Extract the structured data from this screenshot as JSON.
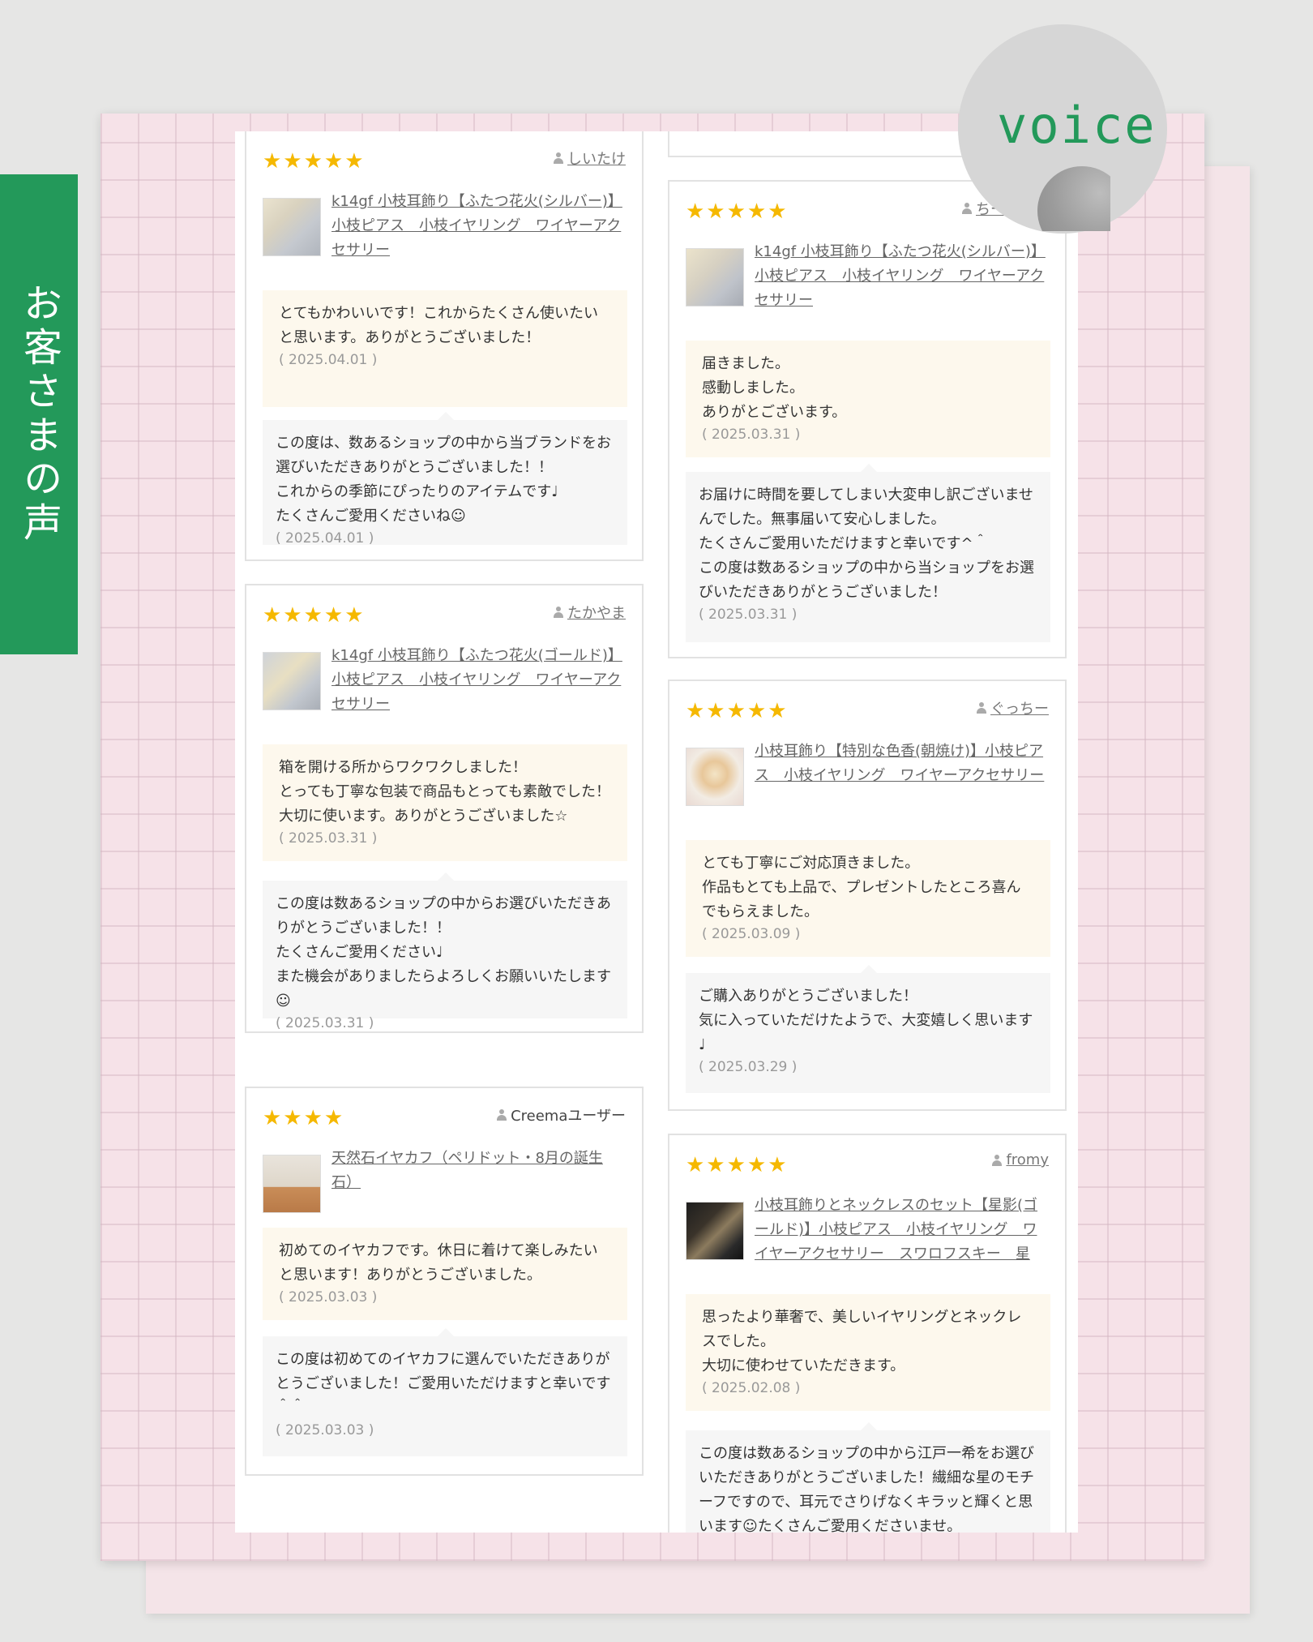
{
  "side_label": "お客さまの声",
  "badge": "voice",
  "reviews": [
    {
      "stars": "★★★★★",
      "user": "しいたけ",
      "product": "k14gf 小枝耳飾り【ふたつ花火(シルバー)】小枝ピアス　小枝イヤリング　ワイヤーアクセサリー",
      "buyer_msg": "とてもかわいいです！これからたくさん使いたいと思います。ありがとうございました！",
      "buyer_date": "( 2025.04.01 )",
      "shop_msg": "この度は、数あるショップの中から当ブランドをお選びいただきありがとうございました！！\nこれからの季節にぴったりのアイテムです♩\nたくさんご愛用くださいね☺",
      "shop_date": "( 2025.04.01 )"
    },
    {
      "stars": "★★★★★",
      "user": "たかやま",
      "product": "k14gf 小枝耳飾り【ふたつ花火(ゴールド)】小枝ピアス　小枝イヤリング　ワイヤーアクセサリー",
      "buyer_msg": "箱を開ける所からワクワクしました！\nとっても丁寧な包装で商品もとっても素敵でした！大切に使います。ありがとうございました☆",
      "buyer_date": "( 2025.03.31 )",
      "shop_msg": "この度は数あるショップの中からお選びいただきありがとうございました！！\nたくさんご愛用ください♩\nまた機会がありましたらよろしくお願いいたします☺",
      "shop_date": "( 2025.03.31 )"
    },
    {
      "stars": "★★★★",
      "user": "Creemaユーザー",
      "product": "天然石イヤカフ（ペリドット・8月の誕生石）",
      "buyer_msg": "初めてのイヤカフです。休日に着けて楽しみたいと思います！ありがとうございました。",
      "buyer_date": "( 2025.03.03 )",
      "shop_msg": "この度は初めてのイヤカフに選んでいただきありがとうございました！ご愛用いただけますと幸いです＾＾",
      "shop_date": "( 2025.03.03 )"
    },
    {
      "stars": "★★★★★",
      "user": "ちーちゃん",
      "product": "k14gf 小枝耳飾り【ふたつ花火(シルバー)】小枝ピアス　小枝イヤリング　ワイヤーアクセサリー",
      "buyer_msg": "届きました。\n感動しました。\nありがとございます。",
      "buyer_date": "( 2025.03.31 )",
      "shop_msg": "お届けに時間を要してしまい大変申し訳ございませんでした。無事届いて安心しました。\nたくさんご愛用いただけますと幸いです^＾\nこの度は数あるショップの中から当ショップをお選びいただきありがとうございました！",
      "shop_date": "( 2025.03.31 )"
    },
    {
      "stars": "★★★★★",
      "user": "ぐっちー",
      "product": "小枝耳飾り【特別な色香(朝焼け)】小枝ピアス　小枝イヤリング　ワイヤーアクセサリー",
      "buyer_msg": "とても丁寧にご対応頂きました。\n作品もとても上品で、プレゼントしたところ喜んでもらえました。",
      "buyer_date": "( 2025.03.09 )",
      "shop_msg": "ご購入ありがとうございました！\n気に入っていただけたようで、大変嬉しく思います♩",
      "shop_date": "( 2025.03.29 )"
    },
    {
      "stars": "★★★★★",
      "user": "fromy",
      "product": "小枝耳飾りとネックレスのセット【星影(ゴールド)】小枝ピアス　小枝イヤリング　ワイヤーアクセサリー　スワロフスキー　星",
      "buyer_msg": "思ったより華奢で、美しいイヤリングとネックレスでした。\n大切に使わせていただきます。",
      "buyer_date": "( 2025.02.08 )",
      "shop_msg": "この度は数あるショップの中から江戸一希をお選びいただきありがとうございました！繊細な星のモチーフですので、耳元でさりげなくキラッと輝くと思います☺たくさんご愛用くださいませ。",
      "shop_date": ""
    }
  ]
}
